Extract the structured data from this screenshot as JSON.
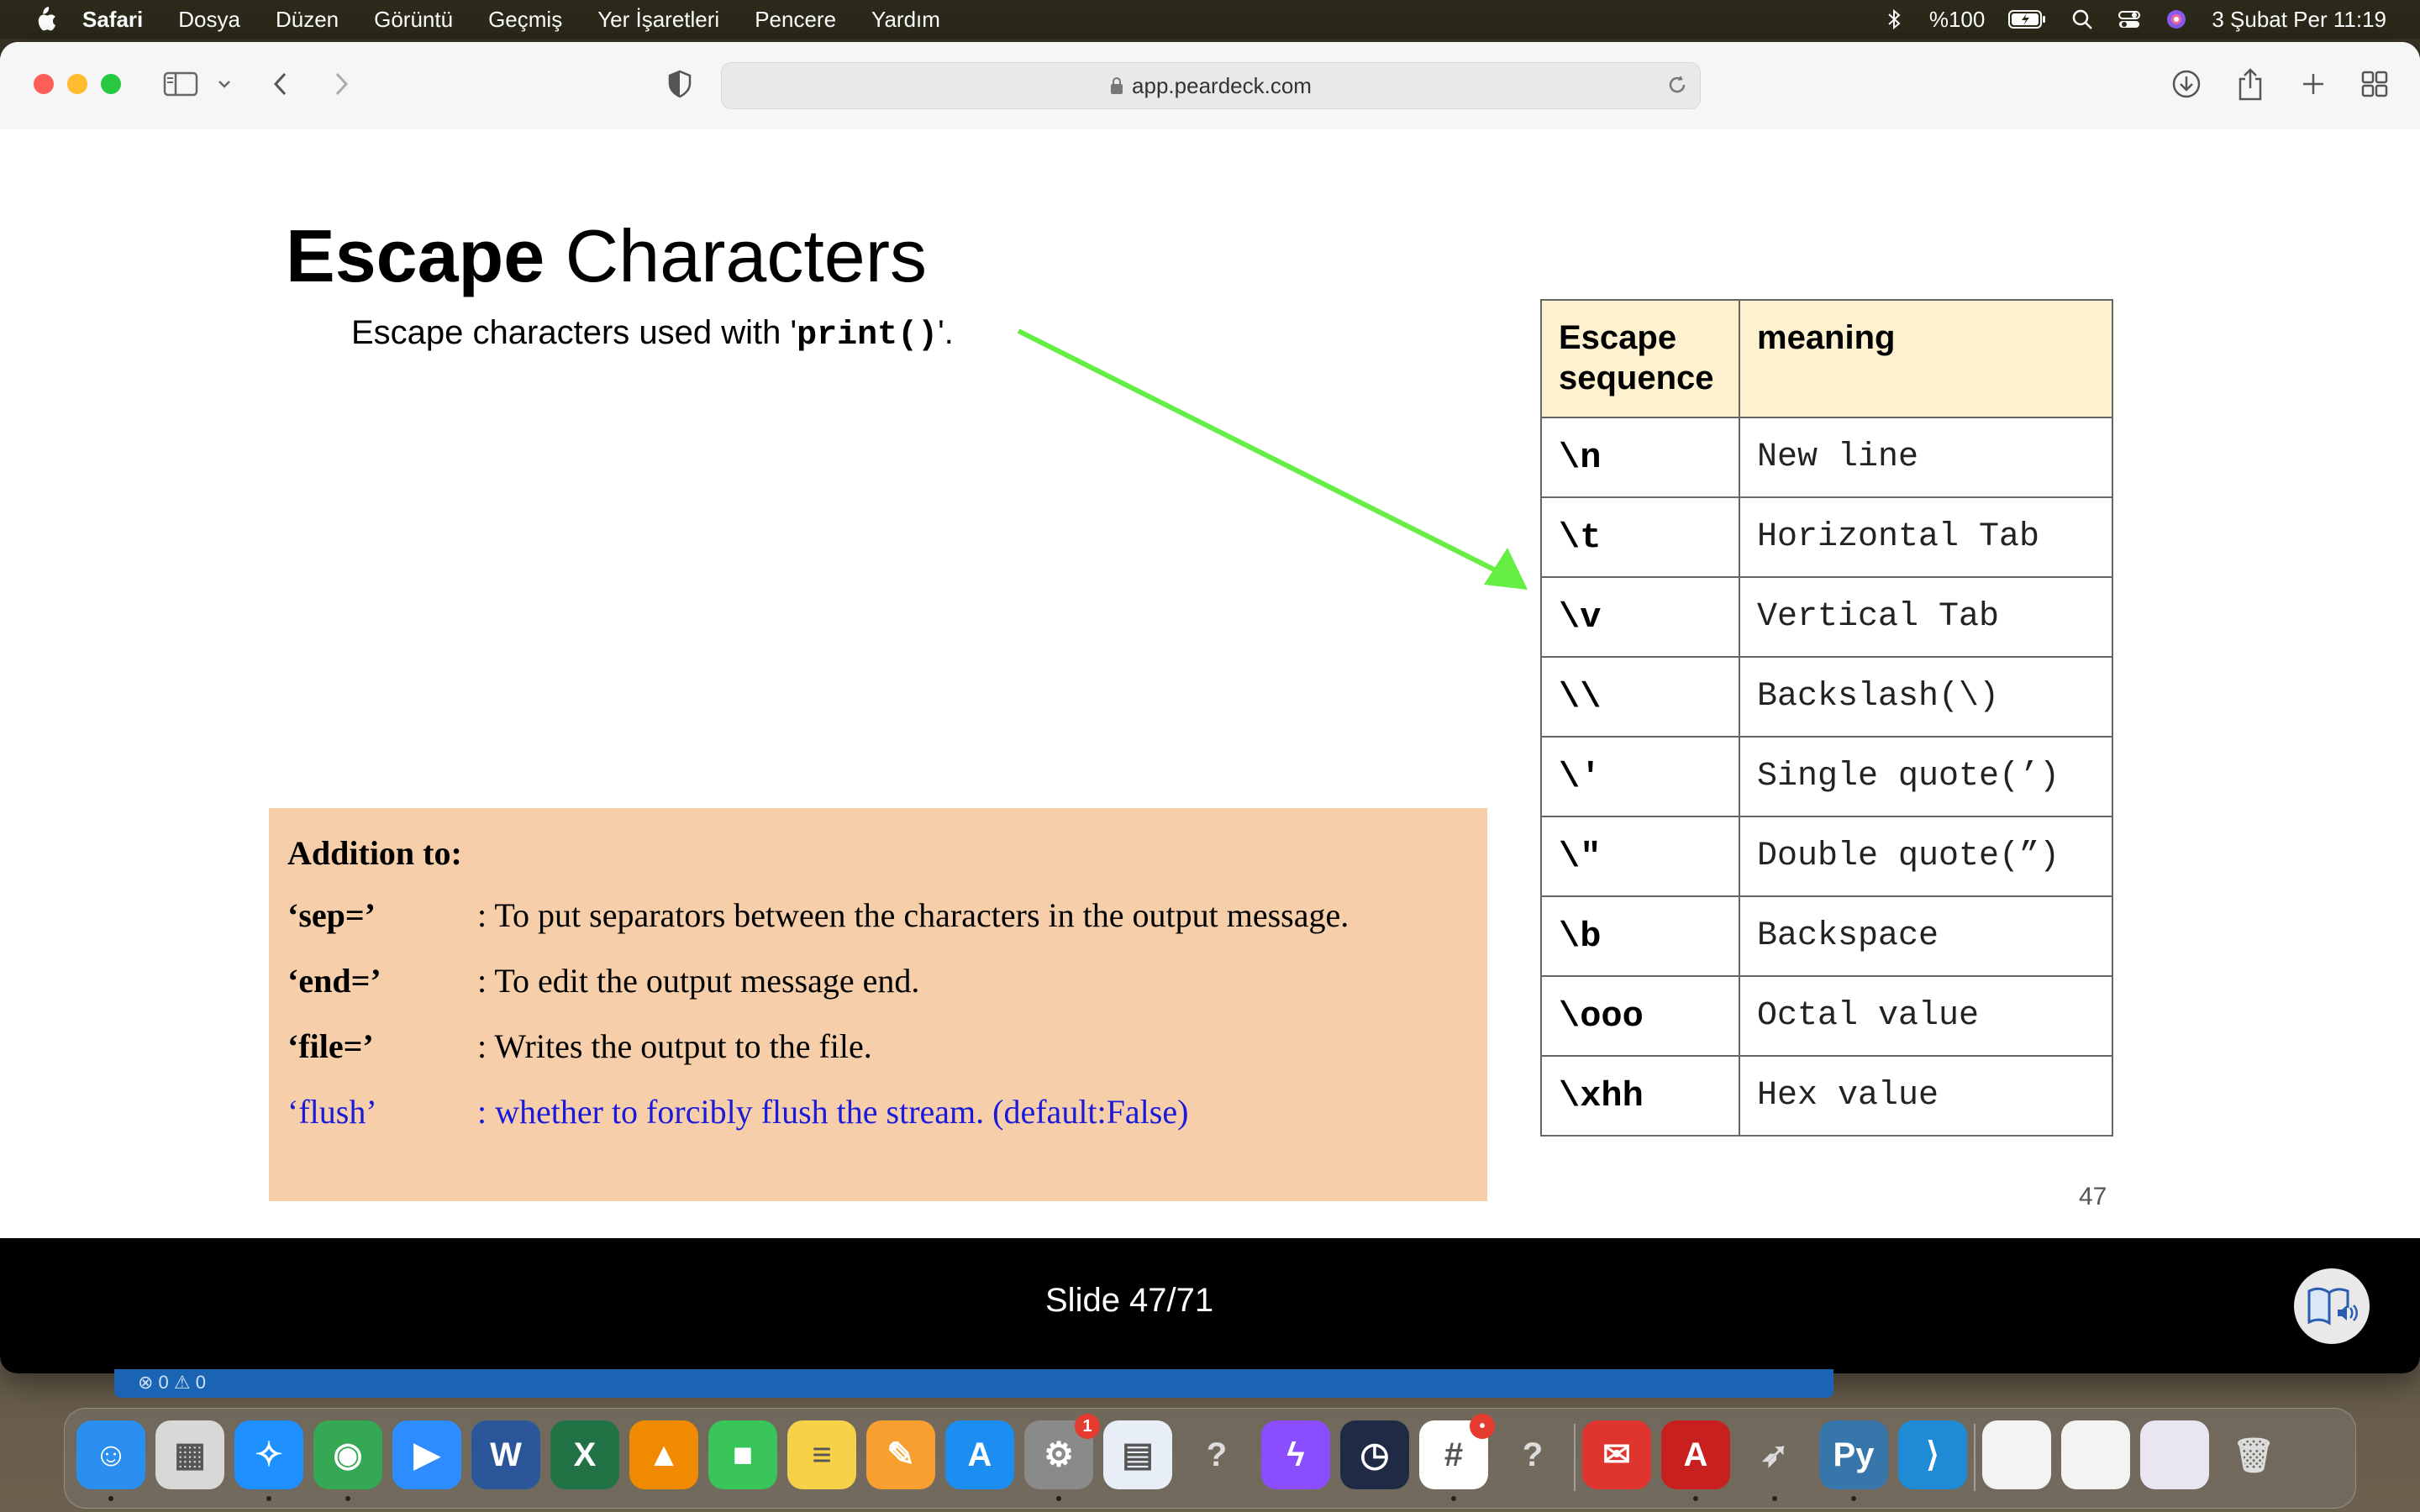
{
  "menubar": {
    "app_name": "Safari",
    "items": [
      "Dosya",
      "Düzen",
      "Görüntü",
      "Geçmiş",
      "Yer İşaretleri",
      "Pencere",
      "Yardım"
    ],
    "battery": "%100",
    "clock": "3 Şubat Per  11:19"
  },
  "browser": {
    "url": "app.peardeck.com"
  },
  "slide": {
    "title_bold": "Escape",
    "title_rest": " Characters",
    "subtitle_pre": "Escape characters used with '",
    "subtitle_code": "print()",
    "subtitle_post": "'.",
    "arrow_color": "#66ee44",
    "table": {
      "header_seq": "Escape sequence",
      "header_meaning": "meaning",
      "rows": [
        {
          "seq": "\\n",
          "meaning": "New line"
        },
        {
          "seq": "\\t",
          "meaning": "Horizontal Tab"
        },
        {
          "seq": "\\v",
          "meaning": "Vertical Tab"
        },
        {
          "seq": "\\\\",
          "meaning": "Backslash(\\)"
        },
        {
          "seq": "\\′",
          "meaning": "Single quote(’)"
        },
        {
          "seq": "\\″",
          "meaning": "Double quote(”)"
        },
        {
          "seq": "\\b",
          "meaning": "Backspace"
        },
        {
          "seq": "\\ooo",
          "meaning": "Octal value"
        },
        {
          "seq": "\\xhh",
          "meaning": "Hex value"
        }
      ]
    },
    "addition": {
      "heading": "Addition to:",
      "items": [
        {
          "key": "‘sep=’",
          "desc": ": To put separators between the characters in the output message."
        },
        {
          "key": "‘end=’",
          "desc": ": To edit the output message end."
        },
        {
          "key": "‘file=’",
          "desc": ": Writes the output to the file."
        },
        {
          "key": "‘flush’",
          "desc": ": whether to forcibly flush the stream. (default:False)"
        }
      ]
    },
    "page_number": "47"
  },
  "slide_bar": {
    "counter": "Slide 47/71"
  },
  "status_strip": {
    "text": "⊗ 0 ⚠ 0"
  },
  "dock": {
    "icons": [
      {
        "name": "finder-icon",
        "glyph": "☺",
        "color": "#2a8ff0"
      },
      {
        "name": "launchpad-icon",
        "glyph": "▦",
        "color": "#d8d8d8"
      },
      {
        "name": "safari-icon",
        "glyph": "✧",
        "color": "#1e90ff"
      },
      {
        "name": "chrome-icon",
        "glyph": "◉",
        "color": "#34a853"
      },
      {
        "name": "zoom-icon",
        "glyph": "▶",
        "color": "#2d8cff"
      },
      {
        "name": "word-icon",
        "glyph": "W",
        "color": "#2b579a"
      },
      {
        "name": "excel-icon",
        "glyph": "X",
        "color": "#217346"
      },
      {
        "name": "vlc-icon",
        "glyph": "▲",
        "color": "#f08a00"
      },
      {
        "name": "facetime-icon",
        "glyph": "■",
        "color": "#3ac55a"
      },
      {
        "name": "notes-icon",
        "glyph": "≡",
        "color": "#f6d24a"
      },
      {
        "name": "pages-icon",
        "glyph": "✎",
        "color": "#f7a030"
      },
      {
        "name": "app-store-icon",
        "glyph": "A",
        "color": "#1c8ef2"
      },
      {
        "name": "system-preferences-icon",
        "glyph": "⚙",
        "color": "#8a8a8a",
        "badge": "1"
      },
      {
        "name": "preview-icon",
        "glyph": "▤",
        "color": "#e8eef6"
      },
      {
        "name": "help-icon",
        "glyph": "?",
        "color": "transparent"
      },
      {
        "name": "messenger-icon",
        "glyph": "ϟ",
        "color": "#8a4dff"
      },
      {
        "name": "calendar-widget-icon",
        "glyph": "◷",
        "color": "#1f2a44"
      },
      {
        "name": "slack-icon",
        "glyph": "#",
        "color": "#ffffff",
        "badge": "•"
      },
      {
        "name": "help-icon-2",
        "glyph": "?",
        "color": "transparent"
      },
      {
        "name": "mail-icon",
        "glyph": "✉",
        "color": "#e0352f"
      },
      {
        "name": "acrobat-icon",
        "glyph": "A",
        "color": "#c8201e"
      },
      {
        "name": "rocket-icon",
        "glyph": "➶",
        "color": "transparent"
      },
      {
        "name": "python-icon",
        "glyph": "Py",
        "color": "#3776ab"
      },
      {
        "name": "vscode-icon",
        "glyph": "⟩",
        "color": "#1f8ad6"
      },
      {
        "name": "window-thumbnail-1",
        "glyph": "",
        "color": "#f3f3f3"
      },
      {
        "name": "window-thumbnail-2",
        "glyph": "",
        "color": "#f3f3f3"
      },
      {
        "name": "window-thumbnail-3",
        "glyph": "",
        "color": "#e9e6f1"
      },
      {
        "name": "trash-icon",
        "glyph": "🗑",
        "color": "transparent"
      }
    ]
  }
}
